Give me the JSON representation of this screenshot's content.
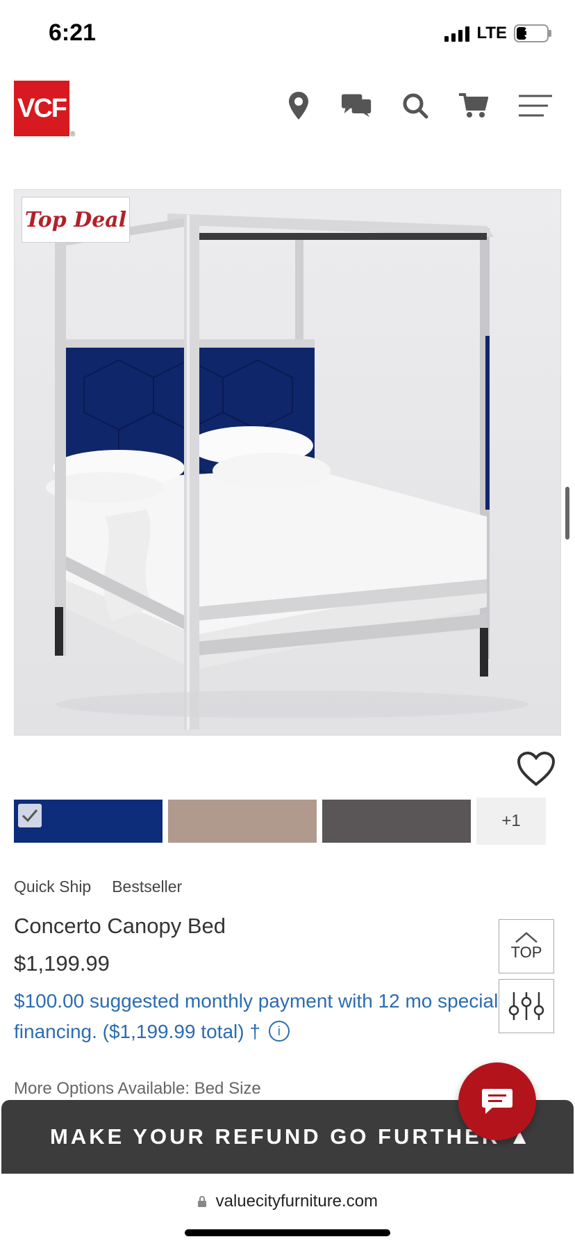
{
  "status_bar": {
    "time": "6:21",
    "network": "LTE",
    "battery": "31",
    "battery_level": 0.31
  },
  "header": {
    "logo_text": "VCF",
    "logo_reg": "®",
    "icons": [
      "location-icon",
      "chat-icon",
      "search-icon",
      "cart-icon",
      "menu-icon"
    ]
  },
  "product": {
    "badge": "Top Deal",
    "image_alt": "Concerto Canopy Bed",
    "swatches": [
      {
        "color": "#0d2c7a",
        "selected": true
      },
      {
        "color": "#b09a8d",
        "selected": false
      },
      {
        "color": "#5a5658",
        "selected": false
      }
    ],
    "more_swatches": "+1",
    "tags": [
      "Quick Ship",
      "Bestseller"
    ],
    "title": "Concerto Canopy Bed",
    "price": "$1,199.99",
    "financing": "$100.00 suggested monthly payment with 12 mo special financing. ($1,199.99 total) †",
    "info_icon": "ⓘ",
    "more_options": "More Options Available: Bed Size"
  },
  "buttons": {
    "top_label": "TOP"
  },
  "promo": {
    "text": "MAKE YOUR REFUND GO FURTHER ▲"
  },
  "browser": {
    "url": "valuecityfurniture.com"
  },
  "colors": {
    "brand_red": "#d71920",
    "link_blue": "#2b6cb0",
    "banner_bg": "#3c3c3c",
    "chat_red": "#b3141c"
  }
}
